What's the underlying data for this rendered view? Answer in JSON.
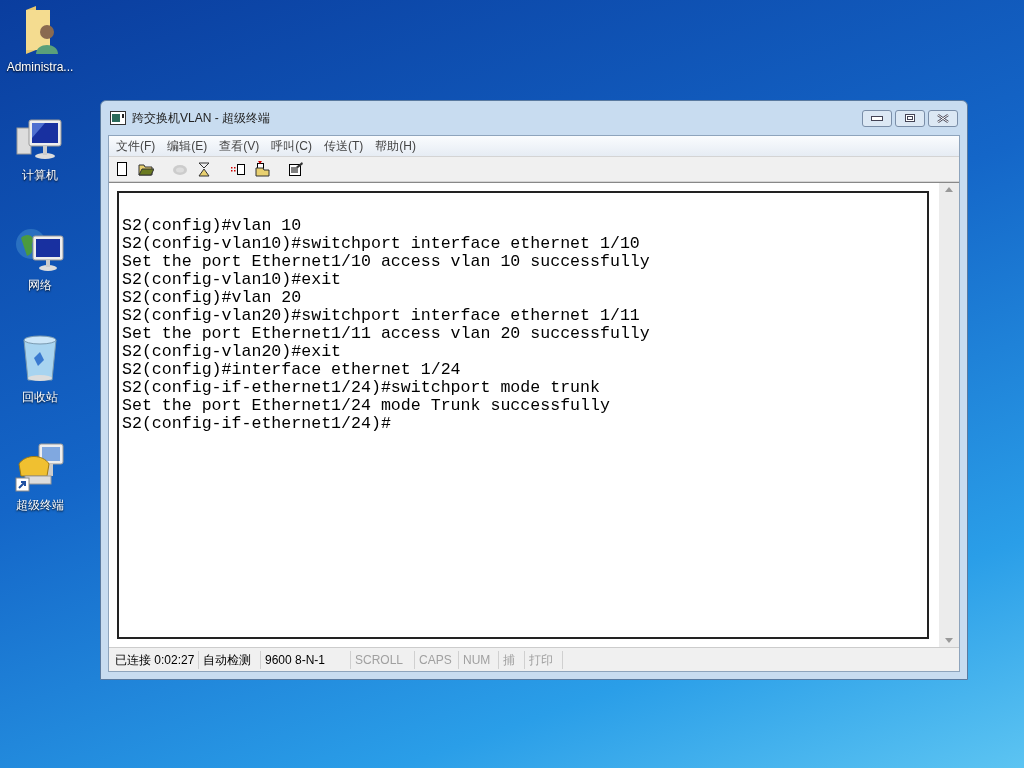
{
  "desktop_icons": [
    {
      "kind": "user-folder",
      "label": "Administra..."
    },
    {
      "kind": "computer",
      "label": "计算机"
    },
    {
      "kind": "network",
      "label": "网络"
    },
    {
      "kind": "recycle-bin",
      "label": "回收站"
    },
    {
      "kind": "terminal-shortcut",
      "label": "超级终端"
    }
  ],
  "window": {
    "title": "跨交换机VLAN - 超级终端"
  },
  "menu": [
    "文件(F)",
    "编辑(E)",
    "查看(V)",
    "呼叫(C)",
    "传送(T)",
    "帮助(H)"
  ],
  "toolbar": [
    {
      "kind": "new",
      "disabled": false
    },
    {
      "kind": "open",
      "disabled": false
    },
    {
      "kind": "call",
      "disabled": true
    },
    {
      "kind": "hangup",
      "disabled": false
    },
    {
      "kind": "send",
      "disabled": false
    },
    {
      "kind": "receive",
      "disabled": false
    },
    {
      "kind": "properties",
      "disabled": false
    }
  ],
  "terminal_lines": [
    "S2(config)#vlan 10",
    "S2(config-vlan10)#switchport interface ethernet 1/10",
    "Set the port Ethernet1/10 access vlan 10 successfully",
    "S2(config-vlan10)#exit",
    "S2(config)#vlan 20",
    "S2(config-vlan20)#switchport interface ethernet 1/11",
    "Set the port Ethernet1/11 access vlan 20 successfully",
    "S2(config-vlan20)#exit",
    "S2(config)#interface ethernet 1/24",
    "S2(config-if-ethernet1/24)#switchport mode trunk",
    "Set the port Ethernet1/24 mode Trunk successfully",
    "S2(config-if-ethernet1/24)#"
  ],
  "status_bar": [
    {
      "text": "已连接 0:02:27",
      "disabled": false
    },
    {
      "text": "自动检测",
      "disabled": false
    },
    {
      "text": "9600 8-N-1",
      "disabled": false
    },
    {
      "text": "SCROLL",
      "disabled": true
    },
    {
      "text": "CAPS",
      "disabled": true
    },
    {
      "text": "NUM",
      "disabled": true
    },
    {
      "text": "捕",
      "disabled": true
    },
    {
      "text": "打印",
      "disabled": true
    }
  ]
}
